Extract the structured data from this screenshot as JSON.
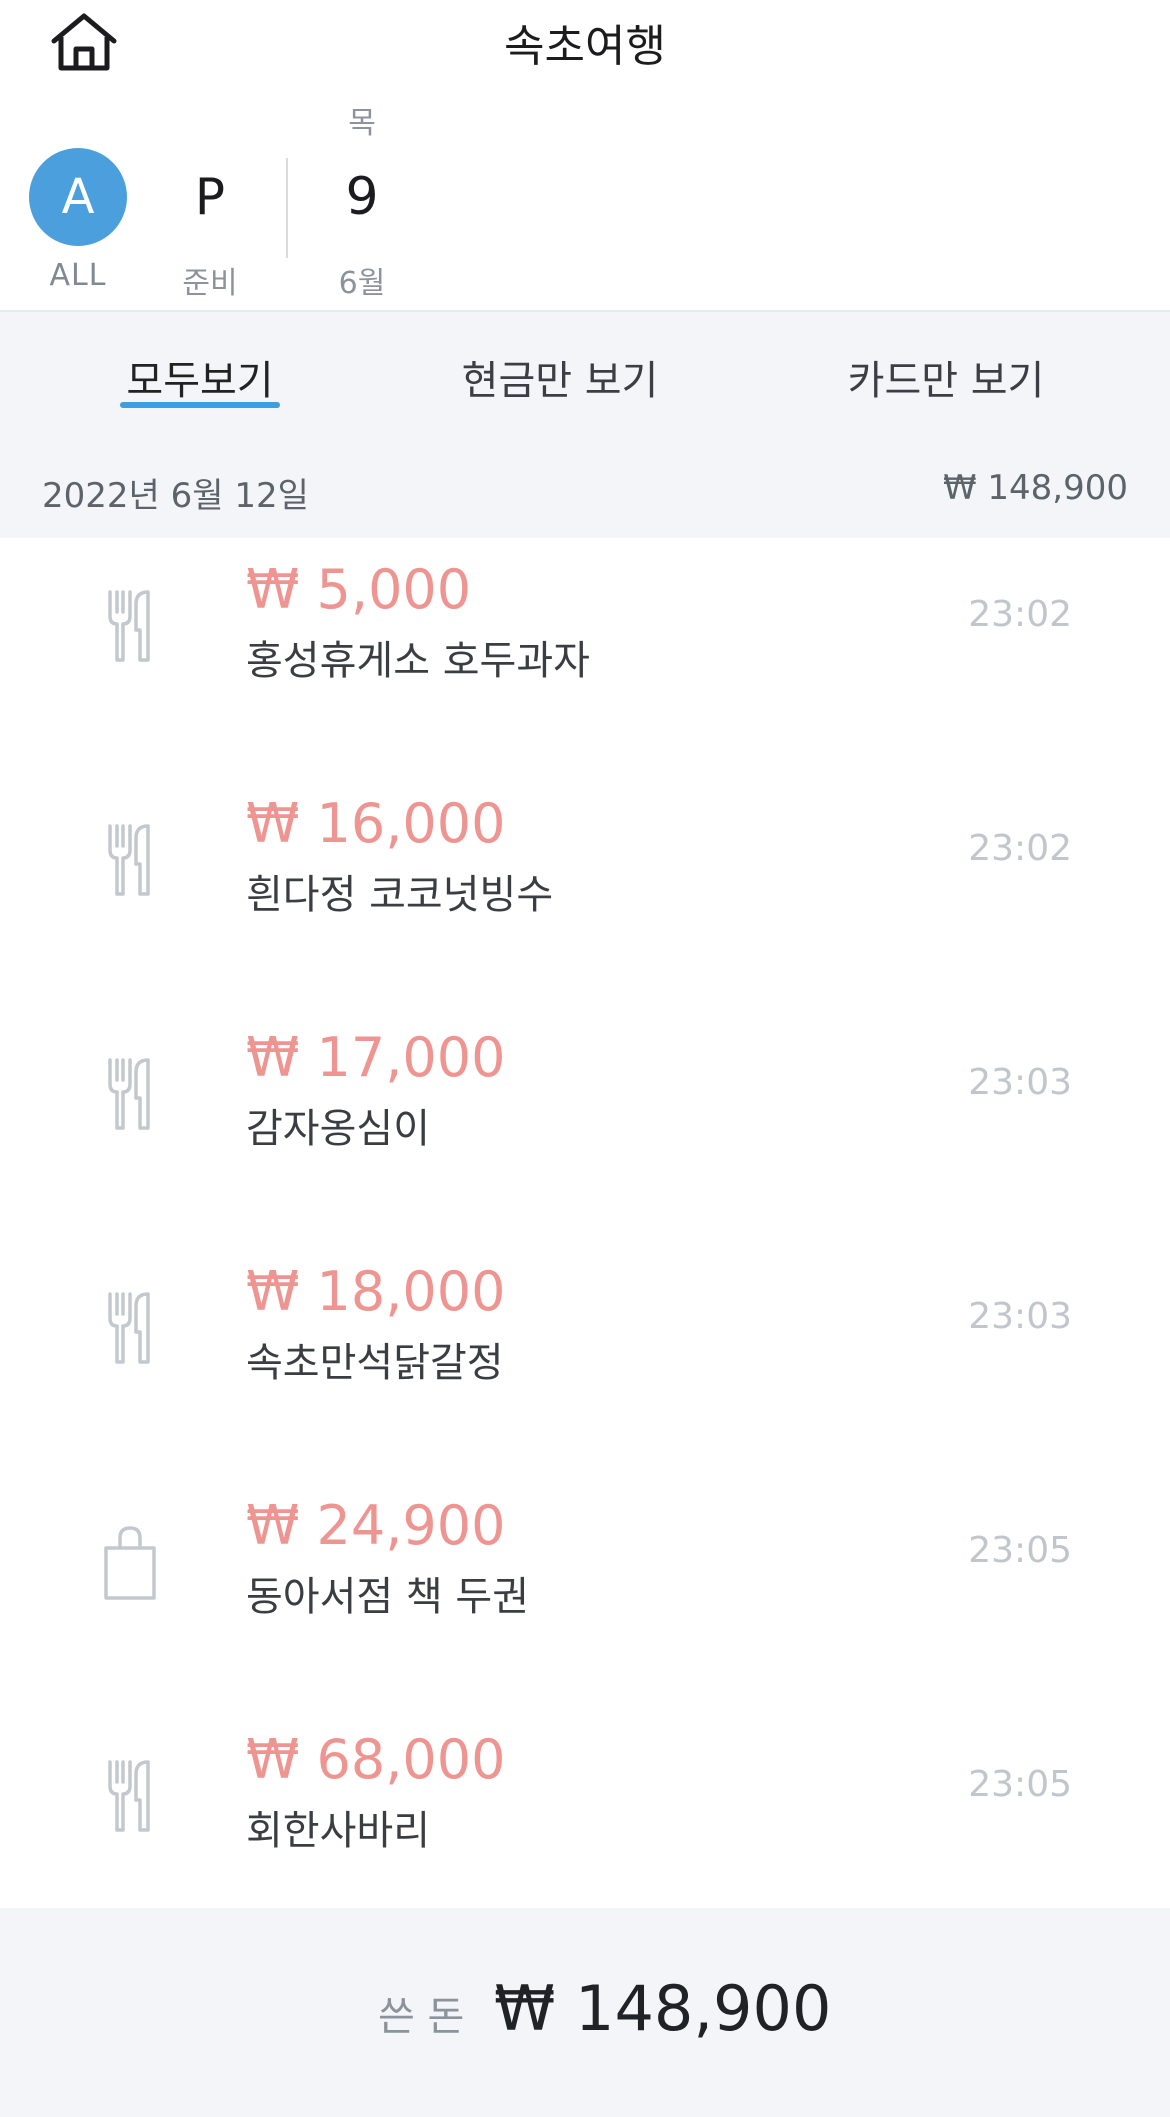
{
  "header": {
    "title": "속초여행",
    "home_icon": "home-icon"
  },
  "day_strip": {
    "all": {
      "letter": "A",
      "label": "ALL",
      "color": "#4a9fdc"
    },
    "prep": {
      "letter": "P",
      "label": "준비"
    },
    "day": {
      "weekday": "목",
      "day": "9",
      "month": "6월"
    }
  },
  "tabs": [
    {
      "label": "모두보기",
      "active": true
    },
    {
      "label": "현금만 보기",
      "active": false
    },
    {
      "label": "카드만 보기",
      "active": false
    }
  ],
  "date_group": {
    "date": "2022년 6월 12일",
    "total": "₩ 148,900"
  },
  "expenses": [
    {
      "icon": "fork-knife-icon",
      "amount": "₩ 5,000",
      "name": "홍성휴게소 호두과자",
      "time": "23:02"
    },
    {
      "icon": "fork-knife-icon",
      "amount": "₩ 16,000",
      "name": "흰다정 코코넛빙수",
      "time": "23:02"
    },
    {
      "icon": "fork-knife-icon",
      "amount": "₩ 17,000",
      "name": "감자옹심이",
      "time": "23:03"
    },
    {
      "icon": "fork-knife-icon",
      "amount": "₩ 18,000",
      "name": "속초만석닭갈정",
      "time": "23:03"
    },
    {
      "icon": "shopping-bag-icon",
      "amount": "₩ 24,900",
      "name": "동아서점 책 두권",
      "time": "23:05"
    },
    {
      "icon": "fork-knife-icon",
      "amount": "₩ 68,000",
      "name": "회한사바리",
      "time": "23:05"
    }
  ],
  "footer": {
    "label": "쓴 돈",
    "total": "₩ 148,900"
  },
  "colors": {
    "accent": "#3d9ee0",
    "amount": "#ee9592",
    "background_gray": "#f3f5f9"
  }
}
